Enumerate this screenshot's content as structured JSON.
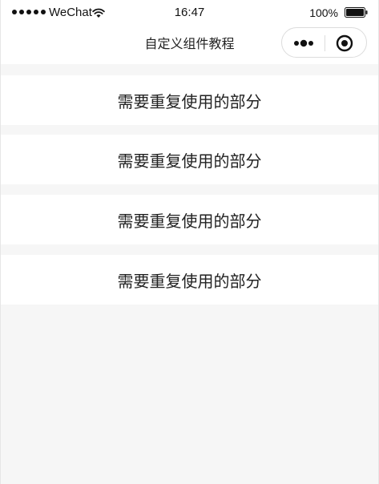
{
  "status_bar": {
    "carrier": "WeChat",
    "time": "16:47",
    "battery_percent": "100%",
    "signal_dots": 5,
    "battery_level": 1.0
  },
  "nav": {
    "title": "自定义组件教程",
    "more_icon": "more-dots-icon",
    "close_icon": "target-close-icon"
  },
  "items": [
    {
      "label": "需要重复使用的部分"
    },
    {
      "label": "需要重复使用的部分"
    },
    {
      "label": "需要重复使用的部分"
    },
    {
      "label": "需要重复使用的部分"
    }
  ],
  "colors": {
    "background": "#f6f6f6",
    "card": "#ffffff",
    "text": "#222222"
  }
}
